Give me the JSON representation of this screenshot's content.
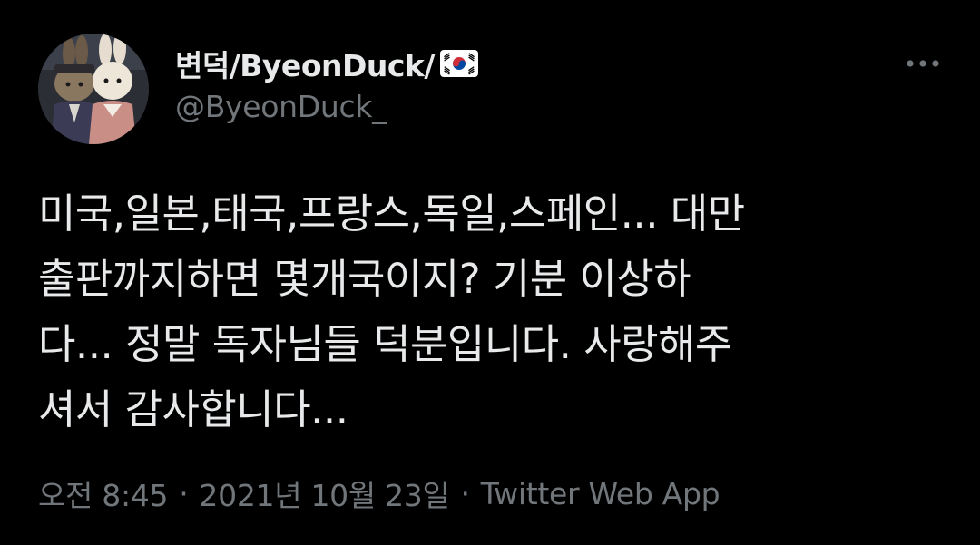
{
  "author": {
    "display_name": "변덕/ByeonDuck/",
    "handle": "@ByeonDuck_",
    "flag_icon": "south-korea-flag-icon",
    "avatar_icon": "profile-photo-two-plush-dolls"
  },
  "menu": {
    "more_icon": "more-options-icon"
  },
  "tweet": {
    "lines": [
      "미국,일본,태국,프랑스,독일,스페인... 대만",
      "출판까지하면 몇개국이지? 기분 이상하",
      "다... 정말 독자님들 덕분입니다. 사랑해주",
      "셔서 감사합니다..."
    ]
  },
  "meta": {
    "time": "오전 8:45",
    "separator": "·",
    "date": "2021년 10월 23일",
    "source": "Twitter Web App"
  },
  "colors": {
    "background": "#000000",
    "primary_text": "#e7e9ea",
    "secondary_text": "#71767b"
  }
}
